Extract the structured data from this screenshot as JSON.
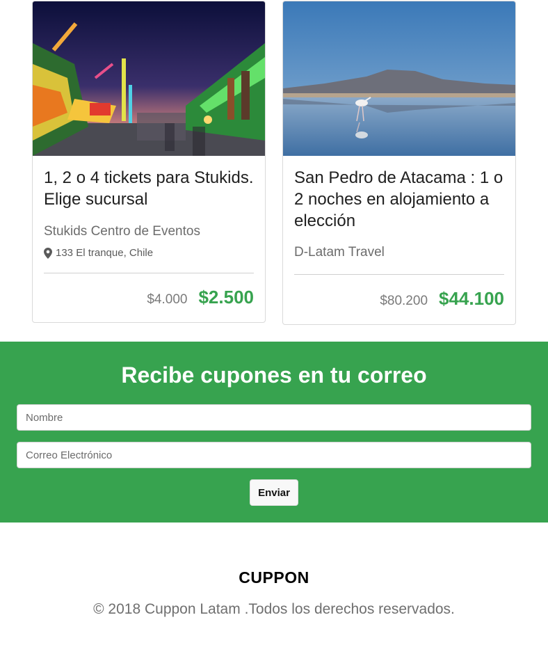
{
  "deals": [
    {
      "image": "carnival-fair-photo",
      "title": "1, 2 o 4 tickets para Stukids. Elige sucursal",
      "merchant": "Stukids Centro de Eventos",
      "location": "133 El tranque, Chile",
      "old_price": "$4.000",
      "new_price": "$2.500"
    },
    {
      "image": "flamingo-lake-photo",
      "title": "San Pedro de Atacama : 1 o 2 noches en alojamiento a elección",
      "merchant": "D-Latam Travel",
      "old_price": "$80.200",
      "new_price": "$44.100"
    }
  ],
  "newsletter": {
    "title": "Recibe cupones en tu correo",
    "name_placeholder": "Nombre",
    "email_placeholder": "Correo Electrónico",
    "submit_label": "Enviar"
  },
  "footer": {
    "brand": "CUPPON",
    "copyright": "© 2018 Cuppon Latam .Todos los derechos reservados."
  },
  "colors": {
    "accent_green": "#37a34f",
    "text_dark": "#1f1f1f",
    "text_muted": "#6c6c6c"
  }
}
